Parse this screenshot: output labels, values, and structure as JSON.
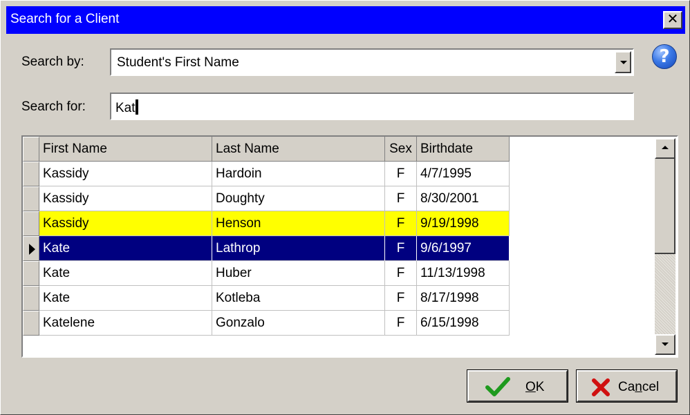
{
  "window": {
    "title": "Search for a Client",
    "close_label": "✕"
  },
  "search_by": {
    "label": "Search by:",
    "value": "Student's First Name"
  },
  "search_for": {
    "label": "Search for:",
    "value": "Kat"
  },
  "help_icon": "?",
  "table": {
    "columns": [
      "First Name",
      "Last Name",
      "Sex",
      "Birthdate"
    ],
    "rows": [
      {
        "first": "Kassidy",
        "last": "Hardoin",
        "sex": "F",
        "birthdate": "4/7/1995"
      },
      {
        "first": "Kassidy",
        "last": "Doughty",
        "sex": "F",
        "birthdate": "8/30/2001"
      },
      {
        "first": "Kassidy",
        "last": "Henson",
        "sex": "F",
        "birthdate": "9/19/1998"
      },
      {
        "first": "Kate",
        "last": "Lathrop",
        "sex": "F",
        "birthdate": "9/6/1997"
      },
      {
        "first": "Kate",
        "last": "Huber",
        "sex": "F",
        "birthdate": "11/13/1998"
      },
      {
        "first": "Kate",
        "last": "Kotleba",
        "sex": "F",
        "birthdate": "8/17/1998"
      },
      {
        "first": "Katelene",
        "last": "Gonzalo",
        "sex": "F",
        "birthdate": "6/15/1998"
      }
    ]
  },
  "buttons": {
    "ok_mnemonic": "O",
    "ok_rest": "K",
    "cancel_start": "Ca",
    "cancel_mnemonic": "n",
    "cancel_end": "cel"
  },
  "colors": {
    "titlebar": "#0000ff",
    "highlight_row": "#ffff00",
    "selected_row": "#000080",
    "ok_check": "#1e9a1e",
    "cancel_x": "#d01010"
  }
}
